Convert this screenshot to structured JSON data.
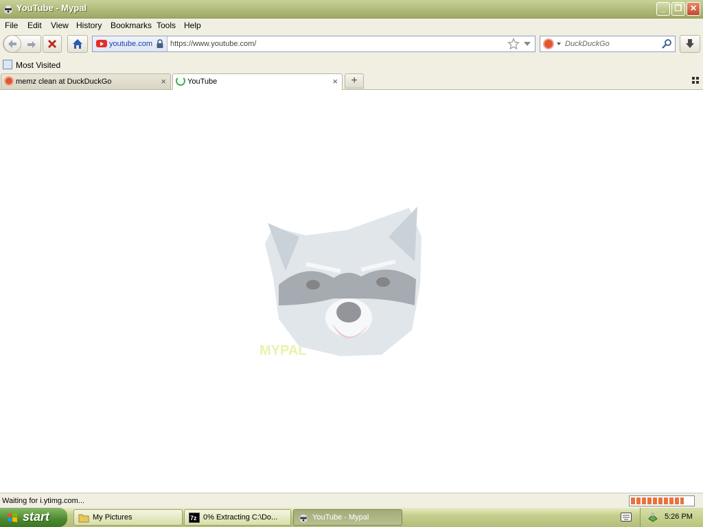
{
  "window": {
    "title": "YouTube - Mypal",
    "buttons": {
      "minimize": "_",
      "maximize": "❐",
      "close": "✕"
    }
  },
  "menu": [
    "File",
    "Edit",
    "View",
    "History",
    "Bookmarks",
    "Tools",
    "Help"
  ],
  "nav": {
    "identity_host": "youtube.com",
    "url": "https://www.youtube.com/",
    "search_placeholder": "DuckDuckGo",
    "icons": [
      "back-arrow-icon",
      "forward-arrow-icon",
      "stop-icon",
      "home-icon",
      "lock-icon",
      "star-icon",
      "search-icon",
      "download-icon"
    ]
  },
  "bookmarks": {
    "most_visited": "Most Visited"
  },
  "tabs": [
    {
      "label": "memz clean at DuckDuckGo",
      "close": "×"
    },
    {
      "label": "YouTube",
      "close": "×"
    }
  ],
  "new_tab": "+",
  "content": {
    "watermark": "MYPAL"
  },
  "status": {
    "text": "Waiting for i.ytimg.com...",
    "progress": 0.85,
    "accent": "#e8733c"
  },
  "taskbar": {
    "start": "start",
    "tasks": [
      {
        "label": "My Pictures"
      },
      {
        "label": "0% Extracting C:\\Do..."
      },
      {
        "label": "YouTube - Mypal"
      }
    ],
    "clock": "5:26 PM"
  },
  "colors": {
    "titlebar": "#aeb876",
    "chrome": "#f1efe2",
    "start_button": "#4c8a2e"
  }
}
